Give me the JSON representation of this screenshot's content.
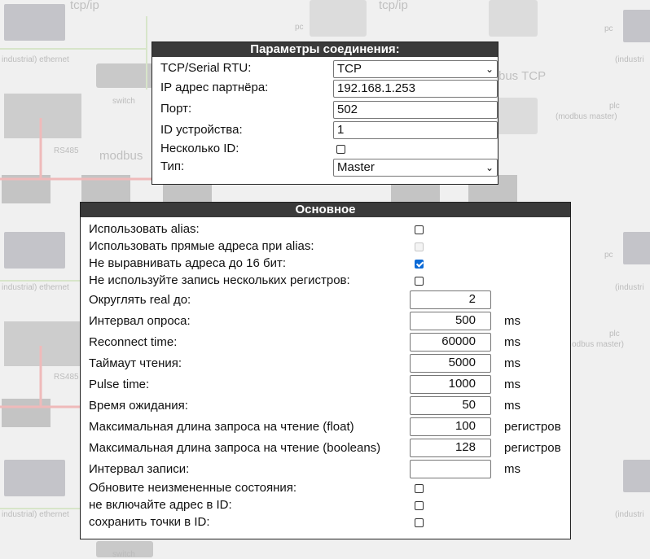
{
  "background": {
    "labels": [
      "tcp/ip",
      "tcp/ip",
      "pc",
      "pc",
      "industrial) ethernet",
      "(industri",
      "switch",
      "bus TCP",
      "plc",
      "(modbus master)",
      "RS485",
      "modbus",
      "industrial) ethernet",
      "pc",
      "(industri",
      "RS485",
      "plc",
      "odbus master)",
      "industrial) ethernet",
      "(industri",
      "switch"
    ]
  },
  "connection": {
    "title": "Параметры соединения:",
    "tcp_serial_label": "TCP/Serial RTU:",
    "tcp_serial_value": "TCP",
    "ip_label": "IP адрес партнёра:",
    "ip_value": "192.168.1.253",
    "port_label": "Порт:",
    "port_value": "502",
    "device_id_label": "ID устройства:",
    "device_id_value": "1",
    "multi_id_label": "Несколько ID:",
    "multi_id_checked": false,
    "type_label": "Тип:",
    "type_value": "Master"
  },
  "main": {
    "title": "Основное",
    "checkboxes_top": [
      {
        "label": "Использовать alias:",
        "checked": false,
        "disabled": false
      },
      {
        "label": "Использовать прямые адреса при alias:",
        "checked": false,
        "disabled": true
      },
      {
        "label": "Не выравнивать адреса до 16 бит:",
        "checked": true,
        "disabled": false
      },
      {
        "label": "Не используйте запись нескольких регистров:",
        "checked": false,
        "disabled": false
      }
    ],
    "fields": [
      {
        "label": "Округлять real до:",
        "value": "2",
        "unit": ""
      },
      {
        "label": "Интервал опроса:",
        "value": "500",
        "unit": "ms"
      },
      {
        "label": "Reconnect time:",
        "value": "60000",
        "unit": "ms"
      },
      {
        "label": "Таймаут чтения:",
        "value": "5000",
        "unit": "ms"
      },
      {
        "label": "Pulse time:",
        "value": "1000",
        "unit": "ms"
      },
      {
        "label": "Время ожидания:",
        "value": "50",
        "unit": "ms"
      },
      {
        "label": "Максимальная длина запроса на чтение (float)",
        "value": "100",
        "unit": "регистров"
      },
      {
        "label": "Максимальная длина запроса на чтение (booleans)",
        "value": "128",
        "unit": "регистров"
      },
      {
        "label": "Интервал записи:",
        "value": "",
        "unit": "ms"
      }
    ],
    "checkboxes_bottom": [
      {
        "label": "Обновите неизмененные состояния:",
        "checked": false
      },
      {
        "label": "не включайте адрес в ID:",
        "checked": false
      },
      {
        "label": "сохранить точки в ID:",
        "checked": false
      }
    ]
  }
}
